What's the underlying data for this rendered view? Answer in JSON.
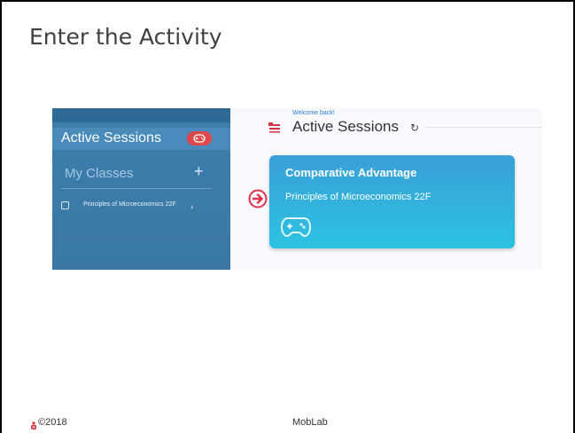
{
  "slide": {
    "title": "Enter the Activity",
    "footer": {
      "copyright": "©2018",
      "brand": "MobLab"
    }
  },
  "app": {
    "sidebar": {
      "active_sessions_label": "Active Sessions",
      "my_classes_label": "My Classes",
      "add_label": "+",
      "class_item_label": "Principles of Microeconomics 22F",
      "chevron": "›"
    },
    "main": {
      "welcome": "Welcome back!",
      "title": "Active Sessions",
      "refresh_glyph": "↻",
      "card": {
        "title": "Comparative Advantage",
        "subtitle": "Principles of Microeconomics 22F"
      }
    }
  },
  "colors": {
    "sidebar": "#3e7fad",
    "badge": "#e0474c",
    "card_top": "#3a9fd6",
    "card_bottom": "#2cc2e2",
    "arrow": "#e0304a"
  },
  "icons": [
    "gamepad-icon",
    "mortarboard-icon",
    "refresh-icon",
    "arrow-right-circle-icon",
    "moblab-logo-icon",
    "checkbox-icon",
    "chevron-right-icon",
    "plus-icon"
  ]
}
